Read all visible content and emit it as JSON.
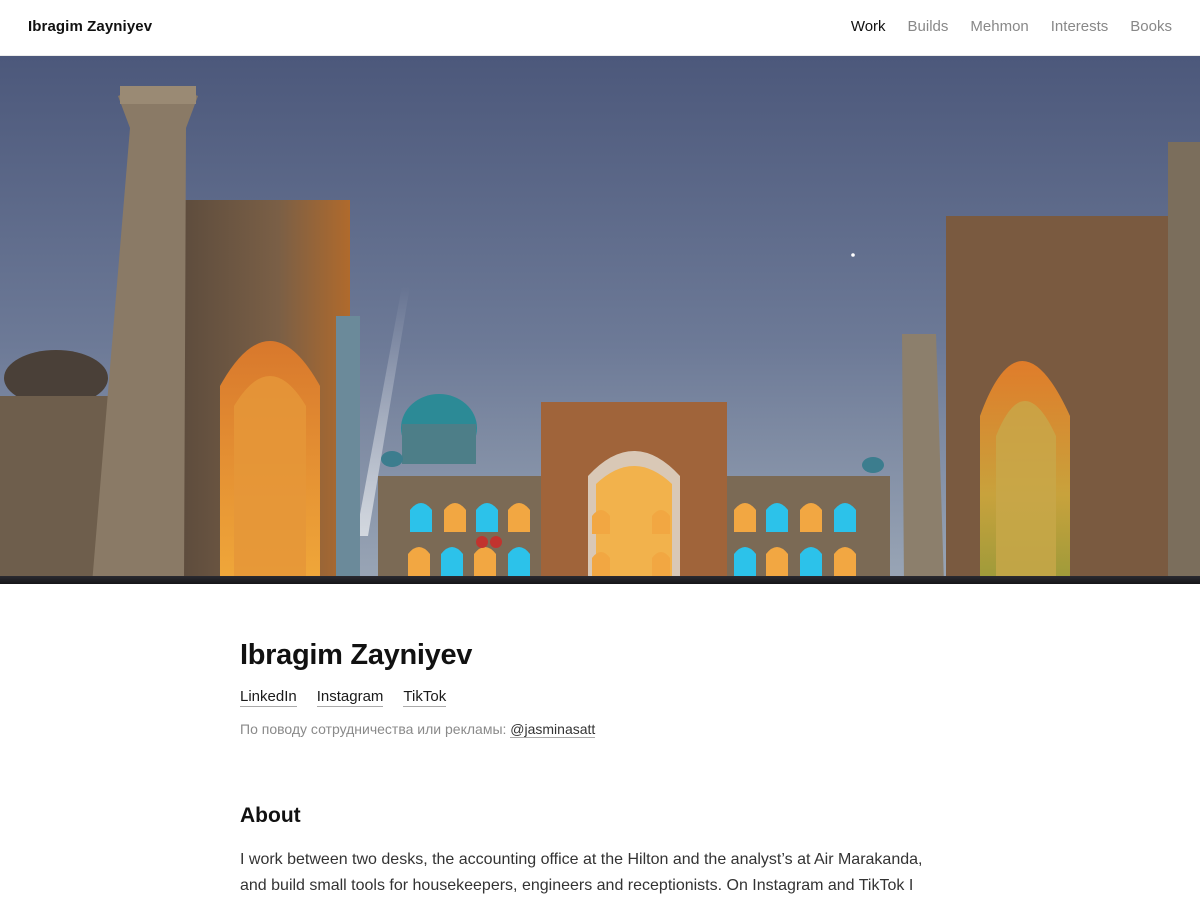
{
  "header": {
    "brand": "Ibragim Zayniyev",
    "nav": [
      {
        "label": "Work",
        "active": true
      },
      {
        "label": "Builds",
        "active": false
      },
      {
        "label": "Mehmon",
        "active": false
      },
      {
        "label": "Interests",
        "active": false
      },
      {
        "label": "Books",
        "active": false
      }
    ]
  },
  "hero": {
    "image": "registan-night-photo",
    "colors": {
      "sky_top": "#4f5c80",
      "sky_bottom": "#8a97ac",
      "amber": "#e8962e",
      "cyan": "#2bb8e0",
      "stone": "#6b5a48"
    }
  },
  "profile": {
    "name": "Ibragim Zayniyev",
    "links": [
      "LinkedIn",
      "Instagram",
      "TikTok"
    ],
    "collab_text": "По поводу сотрудничества или рекламы: ",
    "collab_handle": "@jasminasatt"
  },
  "about": {
    "heading": "About",
    "text": "I work between two desks, the accounting office at the Hilton and the analyst’s at Air Marakanda, and build small tools for housekeepers, engineers and receptionists. On Instagram and TikTok I"
  }
}
